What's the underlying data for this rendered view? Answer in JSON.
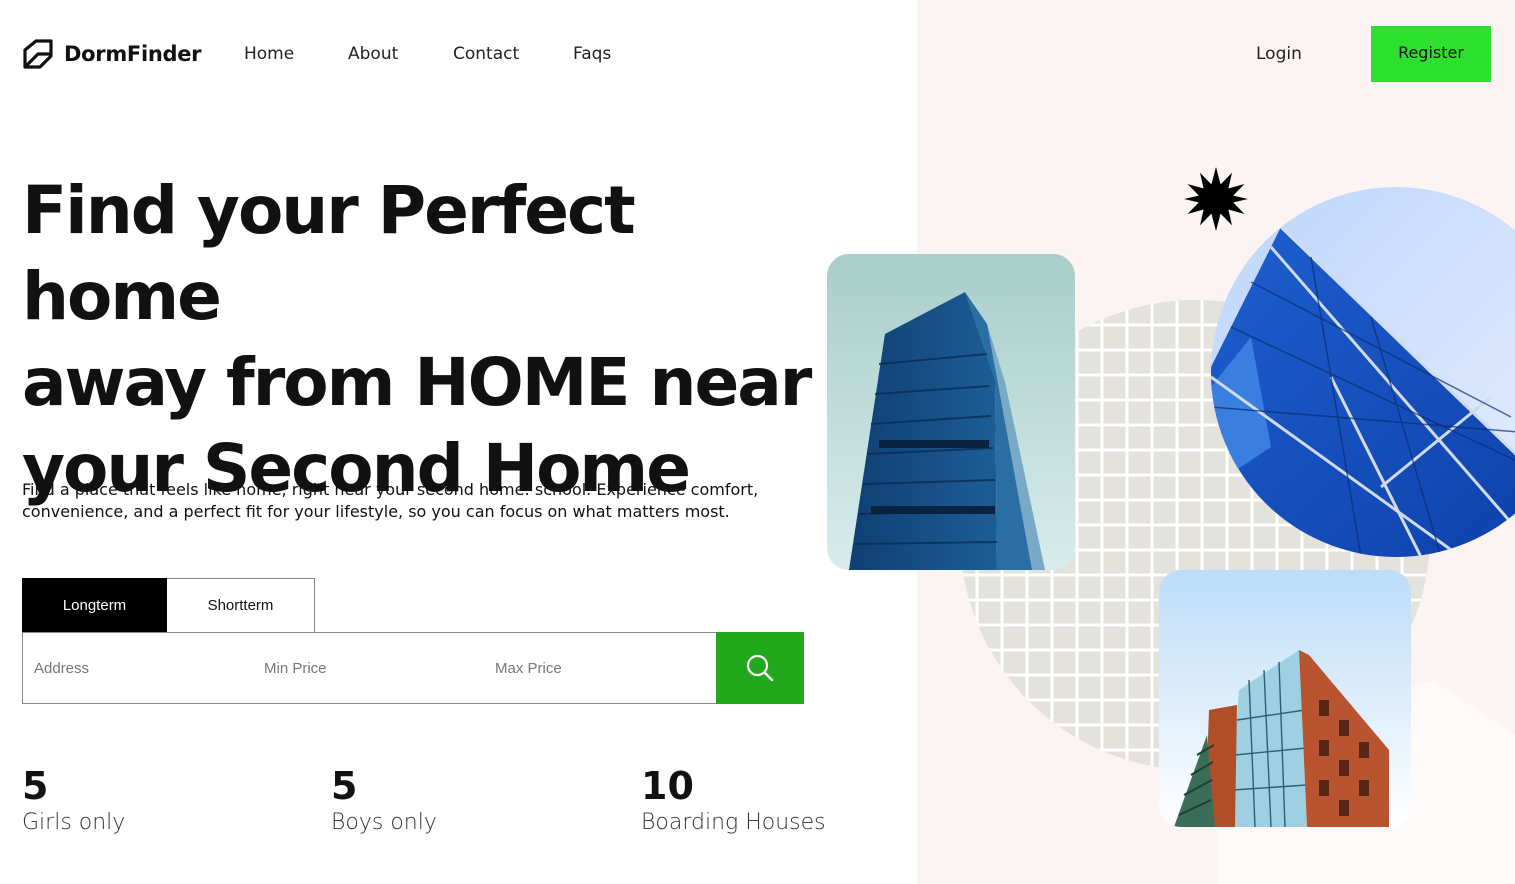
{
  "brand": {
    "name": "DormFinder",
    "icon": "house-logo-icon"
  },
  "nav": {
    "links": [
      {
        "label": "Home"
      },
      {
        "label": "About"
      },
      {
        "label": "Contact"
      },
      {
        "label": "Faqs"
      }
    ],
    "login_label": "Login",
    "register_label": "Register"
  },
  "hero": {
    "title_lines": [
      "Find your Perfect home",
      "away from HOME near",
      "your Second Home"
    ],
    "subtitle_lines": [
      "Find a place that feels like home, right near your second home: school. Experience comfort,",
      "convenience, and a perfect fit for your lifestyle, so you can focus on what matters most."
    ]
  },
  "search": {
    "tabs": [
      {
        "label": "Longterm",
        "active": true
      },
      {
        "label": "Shortterm",
        "active": false
      }
    ],
    "address_placeholder": "Address",
    "min_price_placeholder": "Min Price",
    "max_price_placeholder": "Max Price",
    "button_icon": "search-icon"
  },
  "stats": [
    {
      "value": "5",
      "label": "Girls only"
    },
    {
      "value": "5",
      "label": "Boys only"
    },
    {
      "value": "10",
      "label": "Boarding Houses"
    }
  ],
  "colors": {
    "register_button": "#2ee02e",
    "search_button": "#22a81c",
    "active_tab": "#000000",
    "right_panel": "#fcf4f3"
  }
}
